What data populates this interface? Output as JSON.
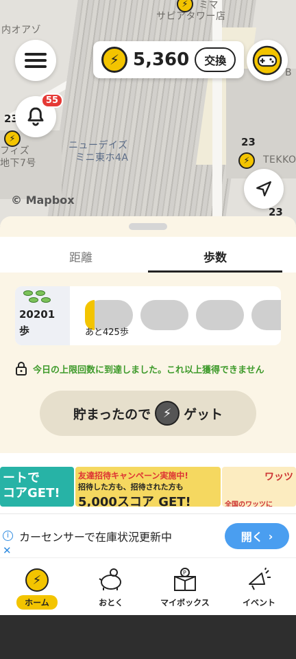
{
  "map": {
    "labels": {
      "top_center": "サピアタワー店",
      "top_left": "内オアゾ",
      "top_right": "ミマ",
      "left_1": "フィズ",
      "left_2": "地下7号",
      "center_1": "ニューデイズ",
      "center_2": "ミニ東ホ4A",
      "right": "TEKKO",
      "edge_b": "B"
    },
    "numbers": {
      "n1": "23",
      "n2": "23",
      "n3": "23"
    },
    "attribution": "© Mapbox"
  },
  "header": {
    "score": "5,360",
    "exchange_label": "交換",
    "notification_count": "55"
  },
  "tabs": [
    {
      "label": "距離",
      "active": false
    },
    {
      "label": "歩数",
      "active": true
    }
  ],
  "steps": {
    "count": "20201",
    "unit": "歩",
    "remaining": "あと425歩",
    "progress_fraction": 0.2
  },
  "limit_message": "今日の上限回数に到達しました。これ以上獲得できません",
  "get_button": {
    "label_before": "貯まったので",
    "label_after": "ゲット"
  },
  "banners": {
    "b1_line1": "ートで",
    "b1_line2": "コアGET!",
    "b2_top": "友達招待キャンペーン実施中!",
    "b2_mid": "招待した方も、招待された方も",
    "b2_big": "5,000スコア GET!",
    "b3_top": "ワッツ",
    "b3_bottom": "全国のワッツに"
  },
  "ad": {
    "text": "カーセンサーで在庫状況更新中",
    "button": "開く"
  },
  "nav": [
    {
      "label": "ホーム",
      "icon": "lightning-coin-icon",
      "active": true
    },
    {
      "label": "おとく",
      "icon": "piggy-bank-icon",
      "active": false
    },
    {
      "label": "マイボックス",
      "icon": "gift-box-icon",
      "active": false
    },
    {
      "label": "イベント",
      "icon": "megaphone-icon",
      "active": false
    }
  ],
  "colors": {
    "accent_yellow": "#f3c400",
    "sheet_bg": "#fbf5e6",
    "limit_green": "#3d9a2a",
    "ad_blue": "#4a9ef0"
  }
}
